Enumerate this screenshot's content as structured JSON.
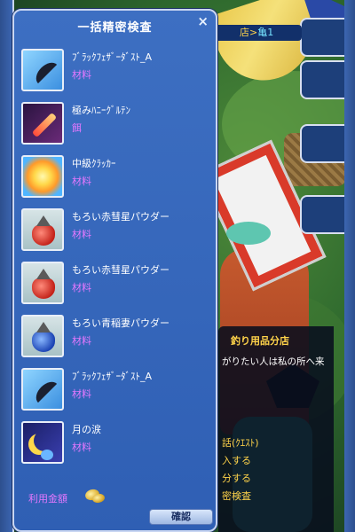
{
  "panel": {
    "title": "一括精密検査",
    "close_symbol": "×",
    "items": [
      {
        "name": "ﾌﾞﾗｯｸﾌｪｻﾞｰﾀﾞｽﾄ_A",
        "category": "材料",
        "icon": "feather-icon"
      },
      {
        "name": "極みﾊﾆｰｸﾞﾙﾃﾝ",
        "category": "餌",
        "icon": "firecracker-stick-icon"
      },
      {
        "name": "中級ｸﾗｯｶｰ",
        "category": "材料",
        "icon": "cracker-icon"
      },
      {
        "name": "もろい赤彗星パウダー",
        "category": "材料",
        "icon": "red-powder-bag-icon"
      },
      {
        "name": "もろい赤彗星パウダー",
        "category": "材料",
        "icon": "red-powder-bag-icon"
      },
      {
        "name": "もろい青稲妻パウダー",
        "category": "材料",
        "icon": "blue-powder-bag-icon"
      },
      {
        "name": "ﾌﾞﾗｯｸﾌｪｻﾞｰﾀﾞｽﾄ_A",
        "category": "材料",
        "icon": "feather-icon"
      },
      {
        "name": "月の涙",
        "category": "材料",
        "icon": "moon-icon"
      }
    ],
    "cost_label": "利用金額",
    "confirm_label": "確認"
  },
  "nav": {
    "prefix": "店>",
    "location": "亀1"
  },
  "shop_dialog": {
    "title": "釣り用品分店",
    "message": "がりたい人は私の所へ来",
    "options": [
      "話(ｸｴｽﾄ)",
      "入する",
      "分する",
      "密検査"
    ]
  },
  "colors": {
    "panel_bg": "#2f5fb4",
    "category_text": "#e678ff",
    "shop_title": "#ffd34a"
  }
}
